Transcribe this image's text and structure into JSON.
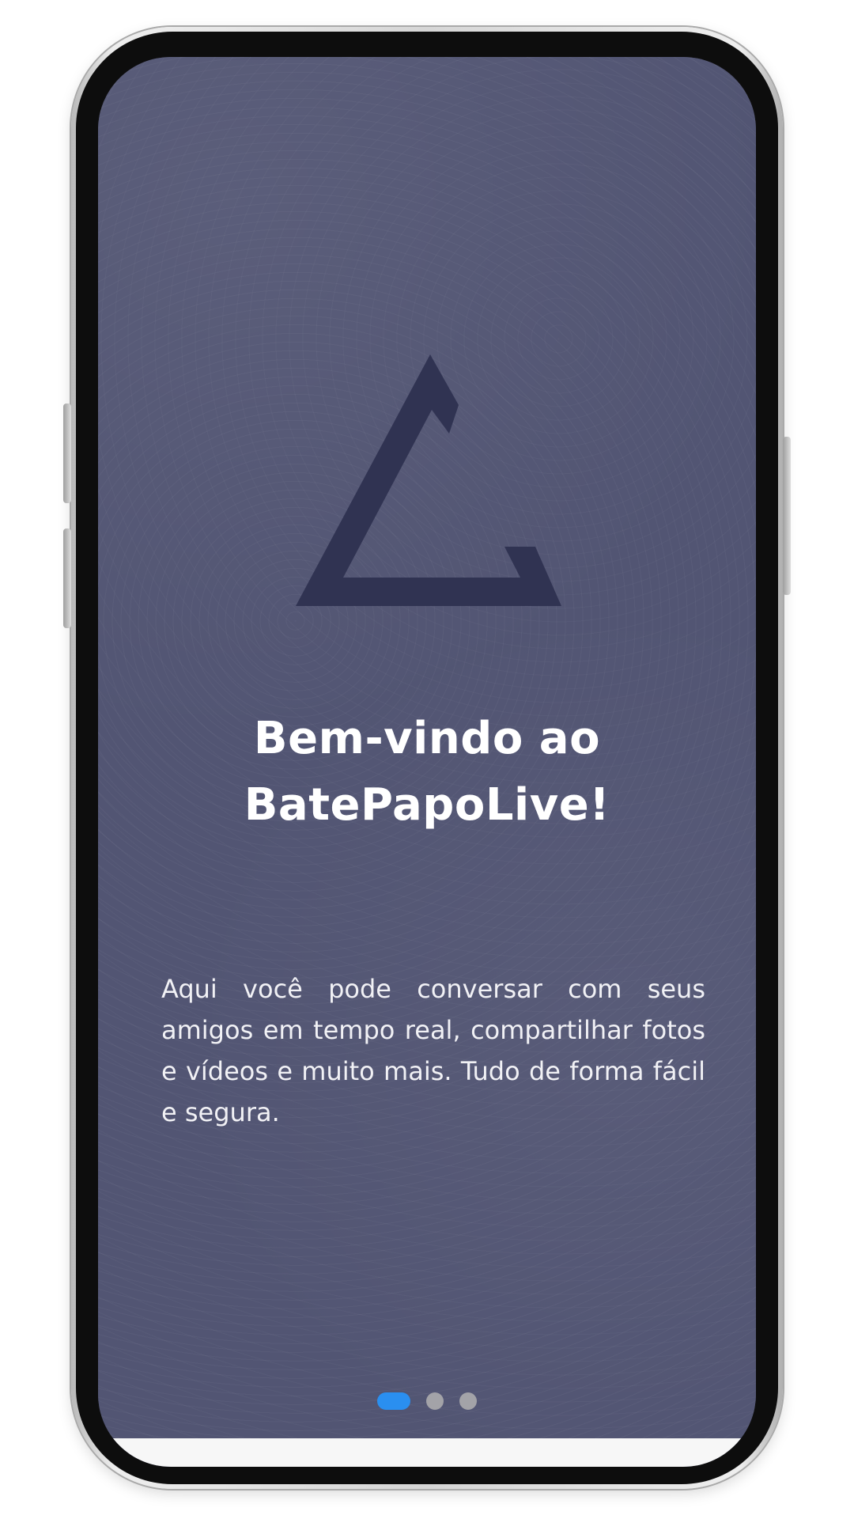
{
  "onboarding": {
    "title_line1": "Bem-vindo ao",
    "title_line2": "BatePapoLive!",
    "description": "Aqui você pode conversar com seus amigos em tempo real, compartilhar fotos e vídeos e muito mais. Tudo de forma fácil e segura."
  },
  "pager": {
    "pages": 3,
    "active_index": 0
  },
  "colors": {
    "screen_background": "#525573",
    "logo": "#303352",
    "title_text": "#ffffff",
    "active_dot": "#2a8ff0",
    "inactive_dot": "#a3a3a8"
  },
  "icons": {
    "logo": "triangle-logo-icon"
  }
}
